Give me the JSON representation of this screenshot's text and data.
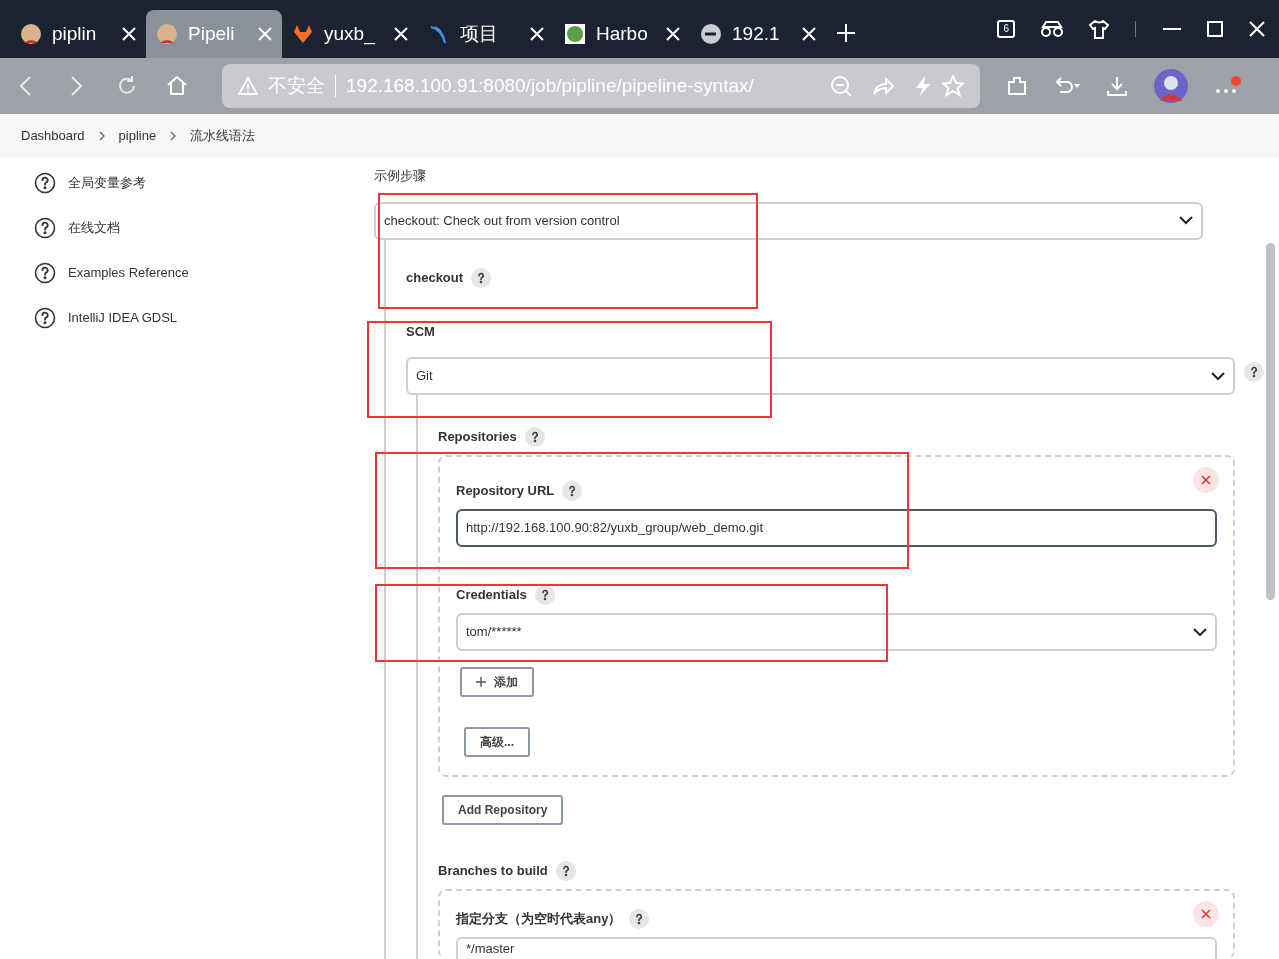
{
  "browser": {
    "tabs": [
      {
        "label": "piplin",
        "selected": false
      },
      {
        "label": "Pipeli",
        "selected": true
      },
      {
        "label": "yuxb_",
        "selected": false
      },
      {
        "label": "项目",
        "selected": false
      },
      {
        "label": "Harbo",
        "selected": false
      },
      {
        "label": "192.1",
        "selected": false
      }
    ],
    "tab_count": "6",
    "security": "不安全",
    "url": "192.168.100.91:8080/job/pipline/pipeline-syntax/"
  },
  "breadcrumb": [
    "Dashboard",
    "pipline",
    "流水线语法"
  ],
  "sidebar": {
    "items": [
      "全局变量参考",
      "在线文档",
      "Examples Reference",
      "IntelliJ IDEA GDSL"
    ]
  },
  "form": {
    "sample_step": {
      "label": "示例步骤",
      "value": "checkout: Check out from version control"
    },
    "step_title": "checkout",
    "scm": {
      "label": "SCM",
      "value": "Git"
    },
    "repositories": {
      "label": "Repositories",
      "url_label": "Repository URL",
      "url": "http://192.168.100.90:82/yuxb_group/web_demo.git",
      "credentials_label": "Credentials",
      "credentials": "tom/******",
      "add_button": "添加",
      "advanced_button": "高级..."
    },
    "add_repository": "Add Repository",
    "branches": {
      "label": "Branches to build",
      "branch_label": "指定分支（为空时代表any）",
      "branch_value": "*/master"
    }
  }
}
